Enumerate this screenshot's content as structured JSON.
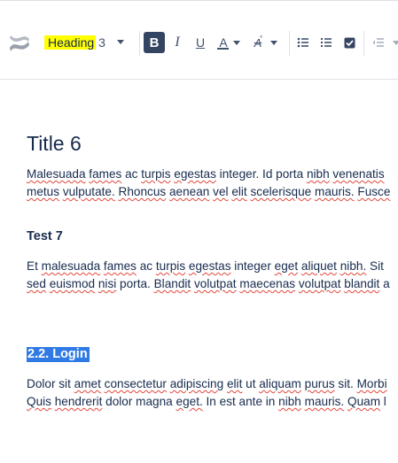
{
  "toolbar": {
    "logo_icon": "confluence-logo-icon",
    "text_style": {
      "label": "Heading",
      "level": "3",
      "highlight_color": "#ffff00"
    },
    "bold_label": "B",
    "italic_label": "I",
    "underline_label": "U",
    "text_color_label": "A",
    "more_formatting_label": "A",
    "icons": [
      "bullet-list-icon",
      "numbered-list-icon",
      "task-checkbox-icon",
      "outdent-icon"
    ],
    "active_color": "#344563"
  },
  "document": {
    "title": "Title 6",
    "paragraph1": {
      "line1": [
        {
          "t": "Malesuada",
          "s": true
        },
        {
          "t": " "
        },
        {
          "t": "fames",
          "s": true
        },
        {
          "t": " ac "
        },
        {
          "t": "turpis",
          "s": true
        },
        {
          "t": " "
        },
        {
          "t": "egestas",
          "s": true
        },
        {
          "t": " integer. Id porta "
        },
        {
          "t": "nibh",
          "s": true
        },
        {
          "t": " "
        },
        {
          "t": "venenatis",
          "s": true
        }
      ],
      "line2": [
        {
          "t": "metus",
          "s": true
        },
        {
          "t": " "
        },
        {
          "t": "vulputate.",
          "s": true
        },
        {
          "t": " "
        },
        {
          "t": "Rhoncus",
          "s": true
        },
        {
          "t": " "
        },
        {
          "t": "aenean",
          "s": true
        },
        {
          "t": " "
        },
        {
          "t": "vel",
          "s": true
        },
        {
          "t": " "
        },
        {
          "t": "elit",
          "s": true
        },
        {
          "t": " "
        },
        {
          "t": "scelerisque",
          "s": true
        },
        {
          "t": " "
        },
        {
          "t": "mauris.",
          "s": true
        },
        {
          "t": " "
        },
        {
          "t": "Fusce",
          "s": true
        }
      ]
    },
    "heading2": "Test 7",
    "paragraph2": {
      "line1": [
        {
          "t": "Et "
        },
        {
          "t": "malesuada",
          "s": true
        },
        {
          "t": " "
        },
        {
          "t": "fames",
          "s": true
        },
        {
          "t": " ac "
        },
        {
          "t": "turpis",
          "s": true
        },
        {
          "t": " "
        },
        {
          "t": "egestas",
          "s": true
        },
        {
          "t": " integer "
        },
        {
          "t": "eget",
          "s": true
        },
        {
          "t": " "
        },
        {
          "t": "aliquet",
          "s": true
        },
        {
          "t": " "
        },
        {
          "t": "nibh.",
          "s": true
        },
        {
          "t": " Sit"
        }
      ],
      "line2": [
        {
          "t": "sed",
          "s": true
        },
        {
          "t": " "
        },
        {
          "t": "euismod",
          "s": true
        },
        {
          "t": " "
        },
        {
          "t": "nisi",
          "s": true
        },
        {
          "t": " porta. "
        },
        {
          "t": "Blandit",
          "s": true
        },
        {
          "t": " "
        },
        {
          "t": "volutpat",
          "s": true
        },
        {
          "t": " "
        },
        {
          "t": "maecenas",
          "s": true
        },
        {
          "t": " "
        },
        {
          "t": "volutpat",
          "s": true
        },
        {
          "t": " "
        },
        {
          "t": "blandit",
          "s": true
        },
        {
          "t": " a"
        }
      ]
    },
    "heading3_selected": "2.2. Login",
    "selection_color": "#2f7ae5",
    "paragraph3": {
      "line1": [
        {
          "t": "Dolor sit "
        },
        {
          "t": "amet",
          "s": true
        },
        {
          "t": " "
        },
        {
          "t": "consectetur",
          "s": true
        },
        {
          "t": " "
        },
        {
          "t": "adipiscing",
          "s": true
        },
        {
          "t": " "
        },
        {
          "t": "elit",
          "s": true
        },
        {
          "t": " ut "
        },
        {
          "t": "aliquam",
          "s": true
        },
        {
          "t": " "
        },
        {
          "t": "purus",
          "s": true
        },
        {
          "t": " sit. "
        },
        {
          "t": "Morbi",
          "s": true
        }
      ],
      "line2": [
        {
          "t": "Quis",
          "s": true
        },
        {
          "t": " "
        },
        {
          "t": "hendrerit",
          "s": true
        },
        {
          "t": " dolor magna "
        },
        {
          "t": "eget.",
          "s": true
        },
        {
          "t": " In est ante in "
        },
        {
          "t": "nibh",
          "s": true
        },
        {
          "t": " "
        },
        {
          "t": "mauris.",
          "s": true
        },
        {
          "t": " "
        },
        {
          "t": "Quam",
          "s": true
        },
        {
          "t": " l"
        }
      ]
    }
  }
}
